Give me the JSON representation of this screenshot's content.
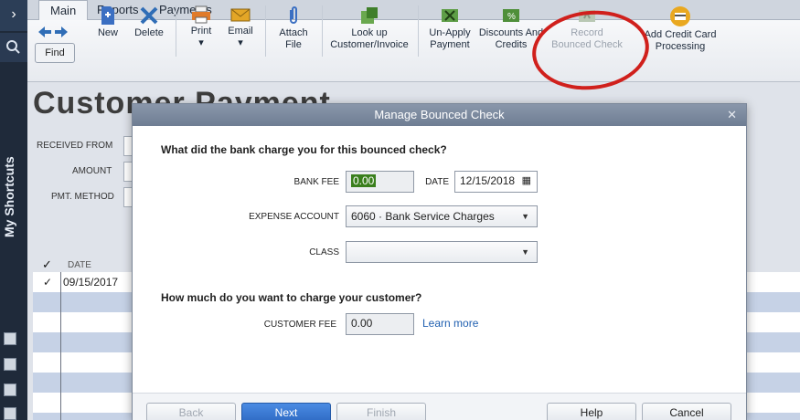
{
  "left_rail": {
    "label": "My Shortcuts"
  },
  "tabs": [
    {
      "label": "Main",
      "active": true
    },
    {
      "label": "Reports",
      "active": false
    },
    {
      "label": "Payments",
      "active": false
    }
  ],
  "toolbar": {
    "find": "Find",
    "new": "New",
    "delete": "Delete",
    "print": "Print",
    "email": "Email",
    "attach": [
      "Attach",
      "File"
    ],
    "lookup": [
      "Look up",
      "Customer/Invoice"
    ],
    "unapply": [
      "Un-Apply",
      "Payment"
    ],
    "discounts": [
      "Discounts And",
      "Credits"
    ],
    "record_bounced": [
      "Record",
      "Bounced Check"
    ],
    "add_cc": [
      "Add Credit Card",
      "Processing"
    ]
  },
  "background_form": {
    "title": "Customer Payment",
    "received_from_label": "RECEIVED FROM",
    "amount_label": "AMOUNT",
    "pmt_method_label": "PMT. METHOD",
    "date_header": "DATE",
    "first_row_date": "09/15/2017"
  },
  "dialog": {
    "title": "Manage Bounced Check",
    "question_bank": "What did the bank charge you for this bounced check?",
    "bank_fee_label": "BANK FEE",
    "bank_fee_value": "0.00",
    "date_label": "DATE",
    "date_value": "12/15/2018",
    "expense_account_label": "EXPENSE ACCOUNT",
    "expense_account_value": "6060 · Bank Service Charges",
    "class_label": "CLASS",
    "class_value": "",
    "question_customer": "How much do you want to charge your customer?",
    "customer_fee_label": "CUSTOMER FEE",
    "customer_fee_value": "0.00",
    "learn_more": "Learn more",
    "buttons": {
      "back": "Back",
      "next": "Next",
      "finish": "Finish",
      "help": "Help",
      "cancel": "Cancel"
    }
  },
  "colors": {
    "highlight_ring": "#d0201c",
    "primary_button": "#2f6bc4",
    "rail": "#1f2a3a"
  }
}
